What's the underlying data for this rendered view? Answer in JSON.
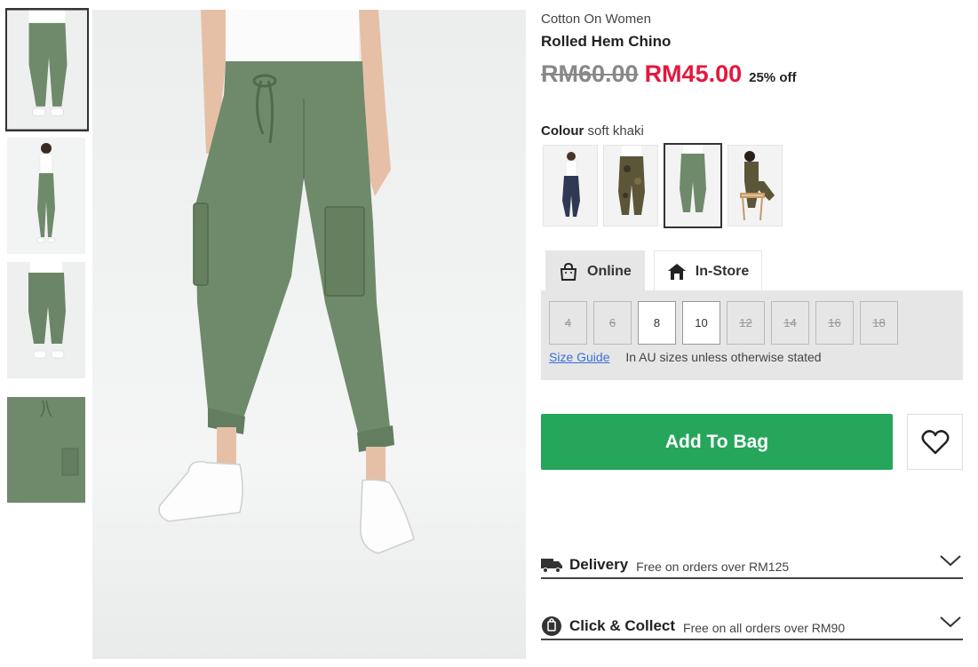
{
  "product": {
    "brand": "Cotton On Women",
    "name": "Rolled Hem Chino",
    "old_price": "RM60.00",
    "new_price": "RM45.00",
    "discount": "25% off"
  },
  "colour": {
    "label": "Colour",
    "value": "soft khaki"
  },
  "tabs": [
    {
      "label": "Online",
      "icon": "shopping-bag-icon",
      "active": true
    },
    {
      "label": "In-Store",
      "icon": "store-icon",
      "active": false
    }
  ],
  "sizes": [
    {
      "label": "4",
      "available": false
    },
    {
      "label": "6",
      "available": false
    },
    {
      "label": "8",
      "available": true
    },
    {
      "label": "10",
      "available": true
    },
    {
      "label": "12",
      "available": false
    },
    {
      "label": "14",
      "available": false
    },
    {
      "label": "16",
      "available": false
    },
    {
      "label": "18",
      "available": false
    }
  ],
  "size_guide": {
    "link": "Size Guide",
    "note": "In AU sizes unless otherwise stated"
  },
  "actions": {
    "add_to_bag": "Add To Bag"
  },
  "delivery": {
    "label": "Delivery",
    "sub": "Free on orders over RM125"
  },
  "click_collect": {
    "label": "Click & Collect",
    "sub": "Free on all orders over RM90"
  },
  "colors": {
    "sale": "#e4173e",
    "add_button": "#26a65b",
    "pants_khaki": "#6f8a6b"
  }
}
